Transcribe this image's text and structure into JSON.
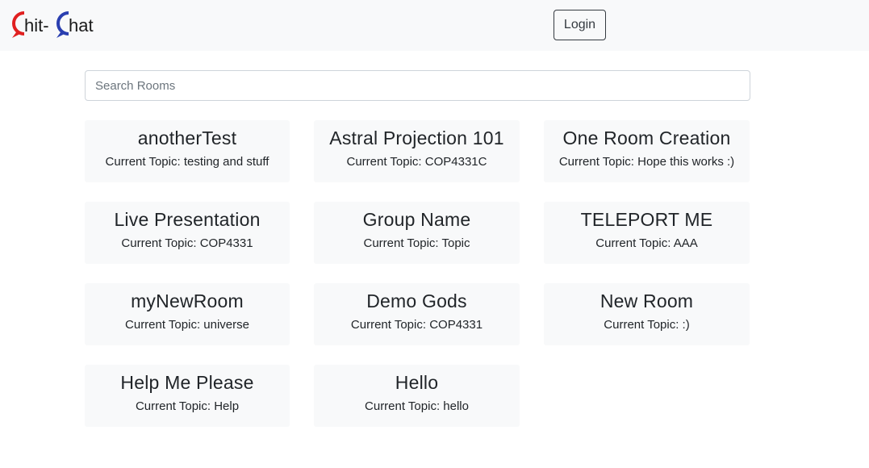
{
  "brand": {
    "name": "Chit-Chat",
    "accent_red": "#e02020",
    "accent_blue": "#2a3fb0"
  },
  "nav": {
    "login_label": "Login"
  },
  "search": {
    "placeholder": "Search Rooms",
    "value": ""
  },
  "rooms": [
    {
      "name": "anotherTest",
      "topic": "Current Topic: testing and stuff"
    },
    {
      "name": "Astral Projection 101",
      "topic": "Current Topic: COP4331C"
    },
    {
      "name": "One Room Creation",
      "topic": "Current Topic: Hope this works :)"
    },
    {
      "name": "Live Presentation",
      "topic": "Current Topic: COP4331"
    },
    {
      "name": "Group Name",
      "topic": "Current Topic: Topic"
    },
    {
      "name": "TELEPORT ME",
      "topic": "Current Topic: AAA"
    },
    {
      "name": "myNewRoom",
      "topic": "Current Topic: universe"
    },
    {
      "name": "Demo Gods",
      "topic": "Current Topic: COP4331"
    },
    {
      "name": "New Room",
      "topic": "Current Topic: :)"
    },
    {
      "name": "Help Me Please",
      "topic": "Current Topic: Help"
    },
    {
      "name": "Hello",
      "topic": "Current Topic: hello"
    }
  ]
}
